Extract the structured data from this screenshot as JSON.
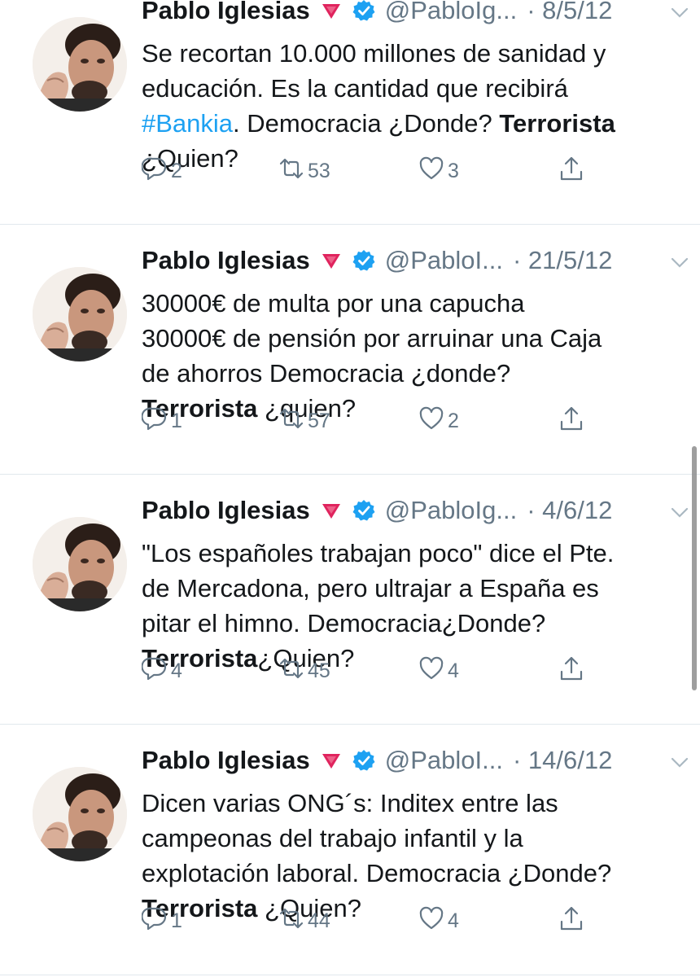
{
  "tweets": [
    {
      "name": "Pablo Iglesias",
      "handle": "@PabloIg...",
      "date": "· 8/5/12",
      "text": [
        {
          "t": "Se recortan 10.000 millones de sanidad y\neducación. Es la cantidad que recibirá\n"
        },
        {
          "t": "#Bankia",
          "style": "hashtag"
        },
        {
          "t": ". Democracia ¿Donde? "
        },
        {
          "t": "Terrorista",
          "style": "bold"
        },
        {
          "t": "\n¿Quien?"
        }
      ],
      "replies": "2",
      "retweets": "53",
      "likes": "3"
    },
    {
      "name": "Pablo Iglesias",
      "handle": "@PabloI...",
      "date": "· 21/5/12",
      "text": [
        {
          "t": "30000€ de multa por una capucha\n30000€ de pensión por arruinar una Caja\nde ahorros Democracia ¿donde?\n"
        },
        {
          "t": "Terrorista",
          "style": "bold"
        },
        {
          "t": " ¿quien?"
        }
      ],
      "replies": "1",
      "retweets": "57",
      "likes": "2"
    },
    {
      "name": "Pablo Iglesias",
      "handle": "@PabloIg...",
      "date": "· 4/6/12",
      "text": [
        {
          "t": "\"Los españoles trabajan poco\" dice el Pte.\nde Mercadona, pero ultrajar a España es\npitar el himno. Democracia¿Donde?\n"
        },
        {
          "t": "Terrorista",
          "style": "bold"
        },
        {
          "t": "¿Quien?"
        }
      ],
      "replies": "4",
      "retweets": "45",
      "likes": "4"
    },
    {
      "name": "Pablo Iglesias",
      "handle": "@PabloI...",
      "date": "· 14/6/12",
      "text": [
        {
          "t": "Dicen varias ONG´s: Inditex entre las\ncampeonas del trabajo infantil y la\nexplotación laboral. Democracia ¿Donde?\n"
        },
        {
          "t": "Terrorista",
          "style": "bold"
        },
        {
          "t": " ¿Quien?"
        }
      ],
      "replies": "1",
      "retweets": "44",
      "likes": "4"
    }
  ],
  "icons": {
    "reply": "reply-icon",
    "retweet": "retweet-icon",
    "like": "like-icon",
    "share": "share-icon",
    "verified": "verified-badge-icon",
    "flag": "red-triangle-flag-icon",
    "caret": "chevron-down-icon"
  },
  "colors": {
    "name": "#14171a",
    "secondary": "#657786",
    "hashtag": "#1da1f2",
    "verified": "#1da1f2",
    "flag": "#e0245e",
    "divider": "#e1e8ed"
  }
}
